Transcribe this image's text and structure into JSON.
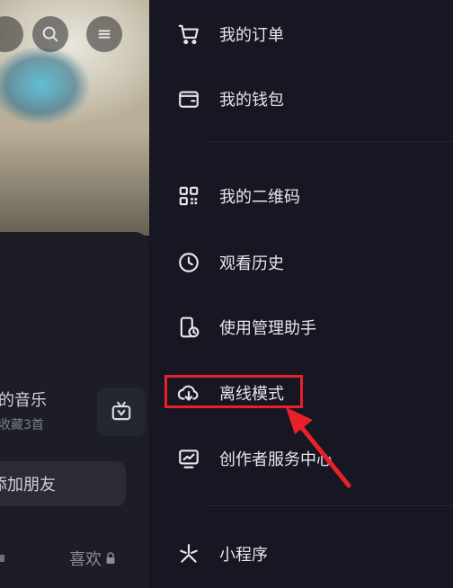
{
  "header": {
    "search_icon": "search-icon",
    "menu_icon": "hamburger-menu-icon"
  },
  "left_panel": {
    "music_title": "的音乐",
    "music_subtitle": "收藏3首",
    "add_friend_label": "添加朋友",
    "like_label": "喜欢"
  },
  "drawer": {
    "items": [
      {
        "label": "我的订单",
        "icon": "cart-icon"
      },
      {
        "label": "我的钱包",
        "icon": "wallet-icon"
      },
      {
        "label": "我的二维码",
        "icon": "qrcode-icon"
      },
      {
        "label": "观看历史",
        "icon": "clock-icon"
      },
      {
        "label": "使用管理助手",
        "icon": "phone-manage-icon"
      },
      {
        "label": "离线模式",
        "icon": "cloud-download-icon"
      },
      {
        "label": "创作者服务中心",
        "icon": "creator-monitor-icon"
      },
      {
        "label": "小程序",
        "icon": "mini-program-icon"
      }
    ]
  },
  "annotation": {
    "highlight_color": "#e8202a",
    "highlighted_item": "离线模式"
  }
}
